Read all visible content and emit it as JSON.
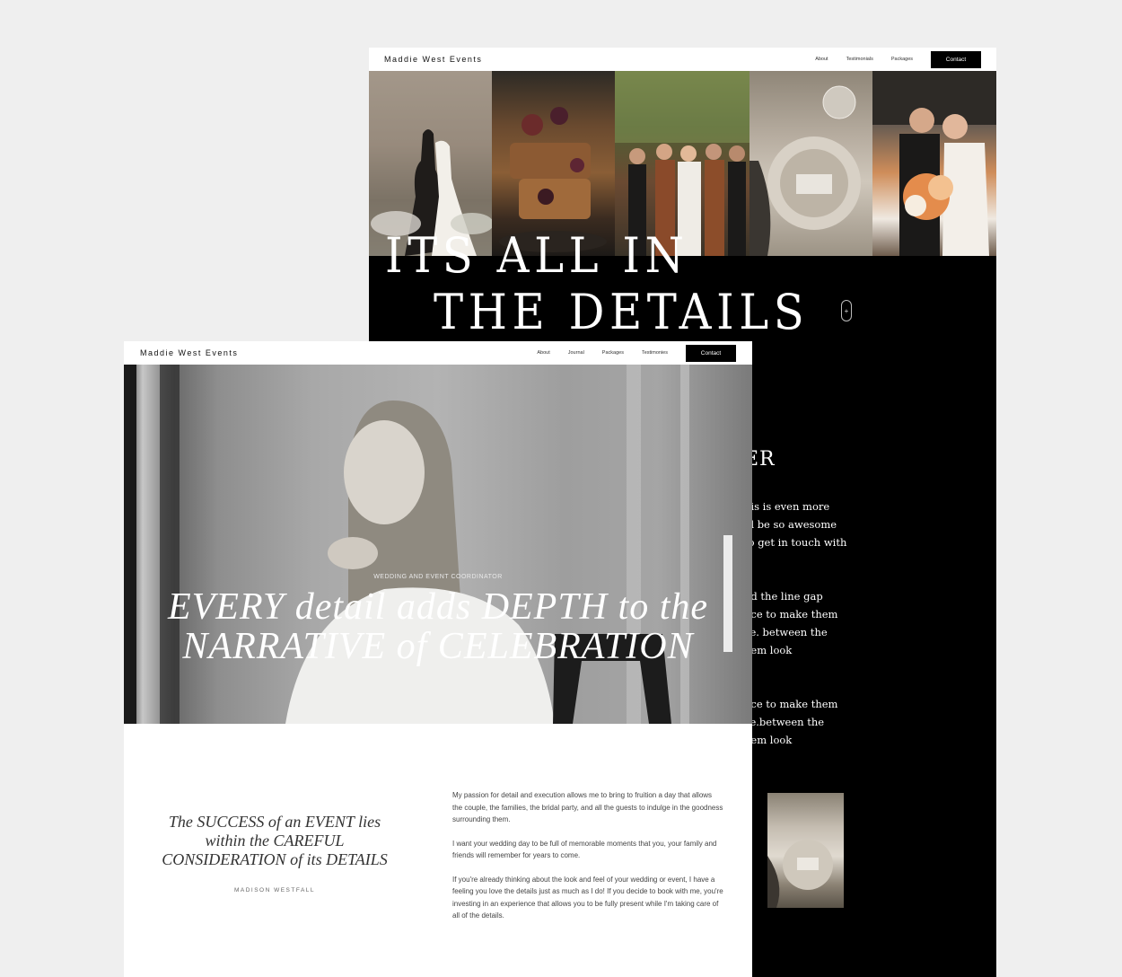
{
  "back": {
    "nav": {
      "logo": "Maddie West Events",
      "links": [
        "About",
        "Testimonials",
        "Packages"
      ],
      "contact": "Contact"
    },
    "headline_line1": "ITS ALL IN",
    "headline_line2": "THE DETAILS",
    "scroll_pill": "+",
    "section_heading": "ER",
    "text_block1": [
      "nis is even more",
      "ill be so awesome",
      "to get in touch with"
    ],
    "text_block2": [
      "nd the line gap",
      "nce to make them",
      "ce. between the",
      "hem look"
    ],
    "text_block3": [
      "nce to make them",
      "ce.between the",
      "hem look"
    ]
  },
  "front": {
    "nav": {
      "logo": "Maddie West Events",
      "links": [
        "About",
        "Journal",
        "Packages",
        "Testimonies"
      ],
      "contact": "Contact"
    },
    "hero": {
      "kicker": "WEDDING AND EVENT COORDINATOR",
      "title_line1": "EVERY detail adds DEPTH to the",
      "title_line2": "NARRATIVE of CELEBRATION"
    },
    "quote": {
      "line1": "The SUCCESS of an EVENT lies",
      "line2": "within the CAREFUL",
      "line3": "CONSIDERATION of its DETAILS",
      "author": "MADISON WESTFALL"
    },
    "body": [
      "My passion for detail and execution allows me to bring to fruition a day that allows the couple, the families, the bridal party, and all the guests to indulge in the goodness surrounding them.",
      "I want your wedding day to be full of memorable moments that you, your family and friends will remember for years to come.",
      "If you're already thinking about the look and feel of your wedding or event, I have a feeling you love the details just as much as I do! If you decide to book with me, you're investing in an experience that allows you to be fully present while I'm taking care of all of the details."
    ]
  },
  "colors": {
    "background": "#efefef",
    "dark": "#000000",
    "light": "#ffffff"
  }
}
